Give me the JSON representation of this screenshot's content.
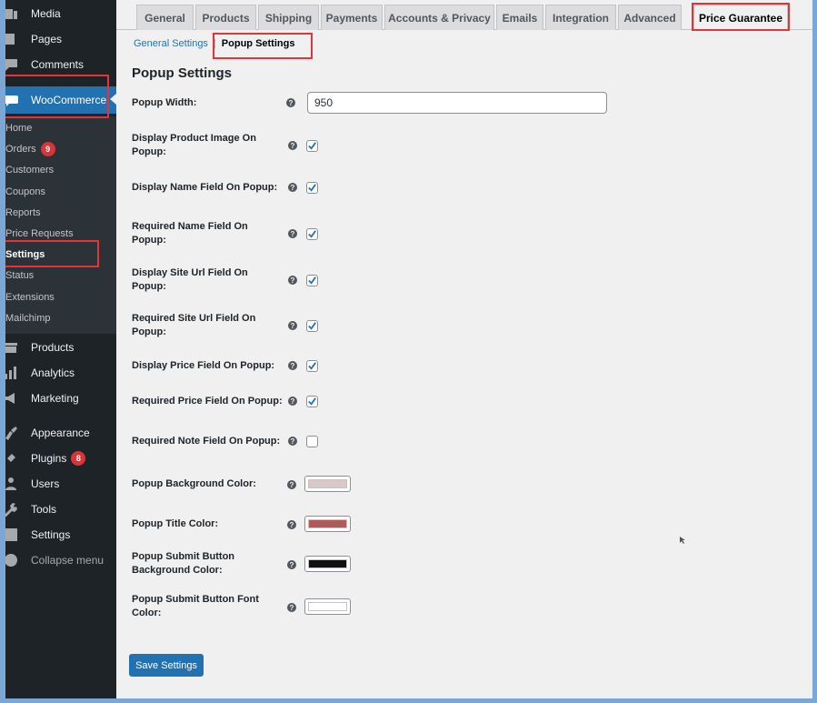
{
  "sidebar": {
    "top_items": [
      {
        "label": "Media",
        "icon": "media-icon"
      },
      {
        "label": "Pages",
        "icon": "pages-icon"
      },
      {
        "label": "Comments",
        "icon": "comments-icon"
      },
      {
        "label": "WooCommerce",
        "icon": "woocommerce-icon"
      }
    ],
    "woo_submenu": [
      {
        "label": "Home"
      },
      {
        "label": "Orders",
        "badge": "9"
      },
      {
        "label": "Customers"
      },
      {
        "label": "Coupons"
      },
      {
        "label": "Reports"
      },
      {
        "label": "Price Requests"
      },
      {
        "label": "Settings",
        "current": true
      },
      {
        "label": "Status"
      },
      {
        "label": "Extensions"
      },
      {
        "label": "Mailchimp"
      }
    ],
    "bottom_items": [
      {
        "label": "Products",
        "icon": "products-icon"
      },
      {
        "label": "Analytics",
        "icon": "analytics-icon"
      },
      {
        "label": "Marketing",
        "icon": "marketing-icon"
      },
      {
        "label": "Appearance",
        "icon": "appearance-icon"
      },
      {
        "label": "Plugins",
        "icon": "plugins-icon",
        "badge": "8"
      },
      {
        "label": "Users",
        "icon": "users-icon"
      },
      {
        "label": "Tools",
        "icon": "tools-icon"
      },
      {
        "label": "Settings",
        "icon": "settings-icon"
      },
      {
        "label": "Collapse menu",
        "icon": "collapse-icon"
      }
    ]
  },
  "tabs": [
    {
      "label": "General"
    },
    {
      "label": "Products"
    },
    {
      "label": "Shipping"
    },
    {
      "label": "Payments"
    },
    {
      "label": "Accounts & Privacy"
    },
    {
      "label": "Emails"
    },
    {
      "label": "Integration"
    },
    {
      "label": "Advanced"
    },
    {
      "label": "Price Guarantee",
      "active": true
    }
  ],
  "subnav": {
    "general_settings": "General Settings",
    "separator": "|",
    "popup_settings": "Popup Settings"
  },
  "page_title": "Popup Settings",
  "fields": {
    "popup_width": {
      "label": "Popup Width:",
      "value": "950"
    },
    "checkboxes": [
      {
        "label": "Display Product Image On Popup:",
        "checked": true
      },
      {
        "label": "Display Name Field On Popup:",
        "checked": true
      },
      {
        "label": "Required Name Field On Popup:",
        "checked": true
      },
      {
        "label": "Display Site Url Field On Popup:",
        "checked": true
      },
      {
        "label": "Required Site Url Field On Popup:",
        "checked": true
      },
      {
        "label": "Display Price Field On Popup:",
        "checked": true
      },
      {
        "label": "Required Price Field On Popup:",
        "checked": true
      },
      {
        "label": "Required Note Field On Popup:",
        "checked": false
      }
    ],
    "colors": [
      {
        "label": "Popup Background Color:",
        "color": "#d8c8c8"
      },
      {
        "label": "Popup Title Color:",
        "color": "#b05a5a"
      },
      {
        "label": "Popup Submit Button Background Color:",
        "color": "#111111"
      },
      {
        "label": "Popup Submit Button Font Color:",
        "color": "#ffffff"
      }
    ]
  },
  "help_glyph": "?",
  "save_button": "Save Settings",
  "colors": {
    "accent": "#2271b1",
    "sidebar_bg": "#1d2327",
    "badge": "#d63638",
    "highlight_box": "#e2343a"
  }
}
